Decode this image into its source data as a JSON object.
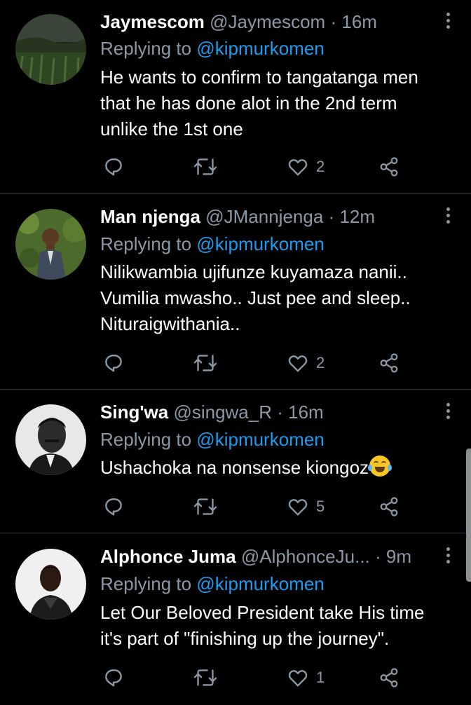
{
  "replying_label": "Replying to",
  "tweets": [
    {
      "name": "Jaymescom",
      "handle": "@Jaymescom",
      "separator": "·",
      "time": "16m",
      "reply_to": "@kipmurkomen",
      "lines": [
        "He wants to confirm to tangatanga men",
        "that he has done alot in the 2nd term",
        "unlike the 1st one"
      ],
      "likes": "2",
      "avatar_icon": "landscape-photo-avatar"
    },
    {
      "name": "Man njenga",
      "handle": "@JMannjenga",
      "separator": "·",
      "time": "12m",
      "reply_to": "@kipmurkomen",
      "lines": [
        "Nilikwambia ujifunze kuyamaza nanii..",
        "Vumilia mwasho.. Just pee and sleep..",
        "Nituraigwithania.."
      ],
      "likes": "2",
      "avatar_icon": "man-in-suit-avatar"
    },
    {
      "name": "Sing'wa",
      "handle": "@singwa_R",
      "separator": "·",
      "time": "16m",
      "reply_to": "@kipmurkomen",
      "lines": [
        "Ushachoka na nonsense kiongoz"
      ],
      "emoji": "face-with-tears-of-joy",
      "likes": "5",
      "avatar_icon": "bw-portrait-avatar"
    },
    {
      "name": "Alphonce Juma",
      "handle": "@AlphonceJu...",
      "separator": "·",
      "time": "9m",
      "reply_to": "@kipmurkomen",
      "lines": [
        "Let Our Beloved President take His time",
        "it's part of \"finishing up the journey\"."
      ],
      "likes": "1",
      "avatar_icon": "man-in-jacket-avatar"
    }
  ],
  "colors": {
    "background": "#000000",
    "text": "#ffffff",
    "secondary": "#8b98a5",
    "accent": "#1d9bf0",
    "divider": "#2f3336"
  },
  "icons": [
    "reply-icon",
    "retweet-icon",
    "like-icon",
    "share-icon",
    "more-icon"
  ]
}
